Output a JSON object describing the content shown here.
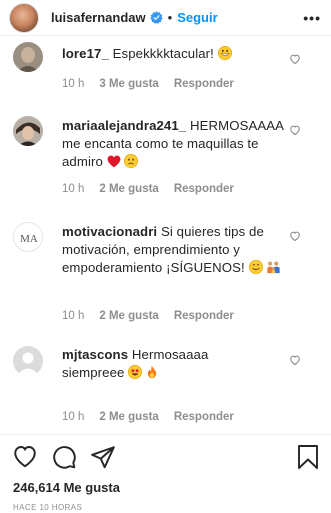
{
  "header": {
    "username": "luisafernandaw",
    "separator": "•",
    "follow_label": "Seguir",
    "more_label": "•••"
  },
  "comments": [
    {
      "username": "lore17_",
      "text": "Espekkkktacular!",
      "time": "10 h",
      "likes": "3 Me gusta",
      "reply": "Responder",
      "avatar_color": "#8a7e72"
    },
    {
      "username": "mariaalejandra241_",
      "text": "HERMOSAAAA me encanta como te maquillas te admiro",
      "time": "10 h",
      "likes": "2 Me gusta",
      "reply": "Responder",
      "avatar_color": "#5a4a40"
    },
    {
      "username": "motivacionadri",
      "text": "Si quieres tips de motivación, emprendimiento y empoderamiento ¡SÍGUENOS!",
      "time": "10 h",
      "likes": "2 Me gusta",
      "reply": "Responder",
      "avatar_monogram": "MA"
    },
    {
      "username": "mjtascons",
      "text": "Hermosaaaa siempreee",
      "time": "10 h",
      "likes": "2 Me gusta",
      "reply": "Responder",
      "avatar_color": "#dbdbdb"
    }
  ],
  "footer": {
    "likes": "246,614 Me gusta",
    "posted": "HACE 10 HORAS"
  },
  "colors": {
    "follow_blue": "#0095f6",
    "meta_gray": "#8e8e8e",
    "text": "#262626"
  },
  "icons": [
    "verified-badge-icon",
    "heart-icon",
    "comment-icon",
    "share-icon",
    "bookmark-icon",
    "more-icon"
  ]
}
